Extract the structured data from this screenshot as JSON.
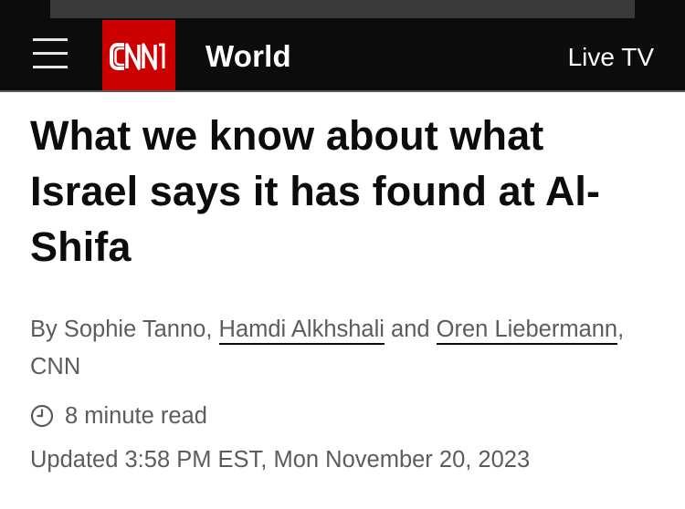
{
  "header": {
    "logo_text": "CNN",
    "section": "World",
    "live_tv_label": "Live TV",
    "menu_icon": "hamburger-menu-icon",
    "brand_color": "#cc0000",
    "bar_color": "#0c0c0c"
  },
  "article": {
    "headline": "What we know about what Israel says it has found at Al-Shifa",
    "byline": {
      "prefix": "By ",
      "author1": "Sophie Tanno",
      "sep1": ", ",
      "author2": "Hamdi Alkhshali",
      "sep2": " and ",
      "author3": "Oren Liebermann",
      "suffix": ", CNN"
    },
    "read_time": "8 minute read",
    "read_time_icon": "clock-icon",
    "updated": "Updated 3:58 PM EST, Mon November 20, 2023"
  }
}
